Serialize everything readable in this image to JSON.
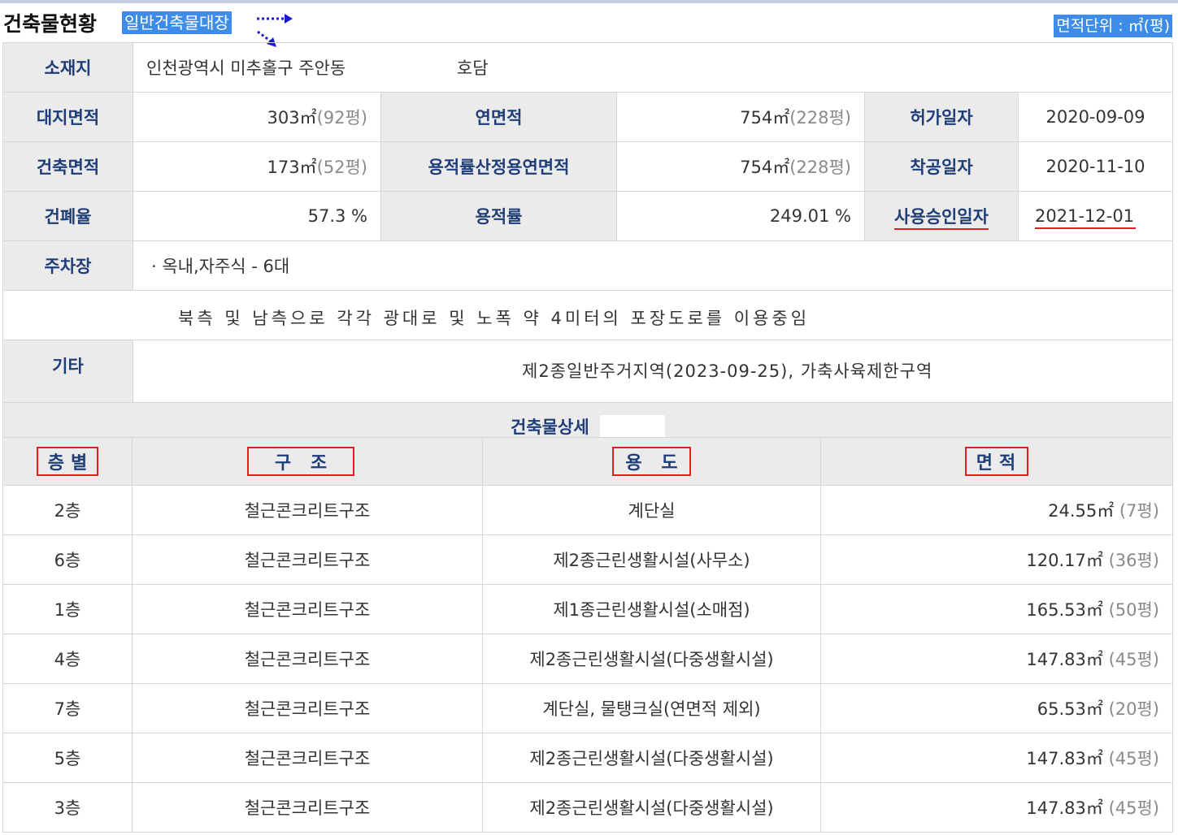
{
  "header": {
    "title": "건축물현황",
    "register_tag": "일반건축물대장",
    "area_unit": "면적단위 : ㎡(평)"
  },
  "summary": {
    "location_label": "소재지",
    "location_value": "인천광역시 미추홀구 주안동",
    "location_ho": "호담",
    "site_area_label": "대지면적",
    "site_area_m2": "303㎡",
    "site_area_py": "(92평)",
    "total_floor_area_label": "연면적",
    "total_floor_area_m2": "754㎡",
    "total_floor_area_py": "(228평)",
    "permit_date_label": "허가일자",
    "permit_date": "2020-09-09",
    "building_area_label": "건축면적",
    "building_area_m2": "173㎡",
    "building_area_py": "(52평)",
    "far_area_label": "용적률산정용연면적",
    "far_area_m2": "754㎡",
    "far_area_py": "(228평)",
    "start_date_label": "착공일자",
    "start_date": "2020-11-10",
    "coverage_label": "건폐율",
    "coverage_value": "57.3 %",
    "far_label": "용적률",
    "far_value": "249.01 %",
    "approval_date_label": "사용승인일자",
    "approval_date": "2021-12-01",
    "parking_label": "주차장",
    "parking_value": "· 옥내,자주식 - 6대",
    "road_note": "북측 및 남측으로 각각 광대로 및 노폭 약 4미터의 포장도로를 이용중임",
    "etc_label": "기타",
    "etc_value": "제2종일반주거지역(2023-09-25), 가축사육제한구역"
  },
  "detail": {
    "title": "건축물상세",
    "headers": [
      "층별",
      "구 조",
      "용 도",
      "면적"
    ],
    "rows": [
      {
        "floor": "2층",
        "structure": "철근콘크리트구조",
        "use": "계단실",
        "area_m2": "24.55㎡",
        "area_py": "(7평)"
      },
      {
        "floor": "6층",
        "structure": "철근콘크리트구조",
        "use": "제2종근린생활시설(사무소)",
        "area_m2": "120.17㎡",
        "area_py": "(36평)"
      },
      {
        "floor": "1층",
        "structure": "철근콘크리트구조",
        "use": "제1종근린생활시설(소매점)",
        "area_m2": "165.53㎡",
        "area_py": "(50평)"
      },
      {
        "floor": "4층",
        "structure": "철근콘크리트구조",
        "use": "제2종근린생활시설(다중생활시설)",
        "area_m2": "147.83㎡",
        "area_py": "(45평)"
      },
      {
        "floor": "7층",
        "structure": "철근콘크리트구조",
        "use": "계단실, 물탱크실(연면적 제외)",
        "area_m2": "65.53㎡",
        "area_py": "(20평)"
      },
      {
        "floor": "5층",
        "structure": "철근콘크리트구조",
        "use": "제2종근린생활시설(다중생활시설)",
        "area_m2": "147.83㎡",
        "area_py": "(45평)"
      },
      {
        "floor": "3층",
        "structure": "철근콘크리트구조",
        "use": "제2종근린생활시설(다중생활시설)",
        "area_m2": "147.83㎡",
        "area_py": "(45평)"
      }
    ]
  },
  "colors": {
    "header_cell_bg": "#ebebeb",
    "label_text": "#1f3e78",
    "highlight_bg": "#3d8ce8",
    "annotation_red": "#e02020",
    "annotation_arrow": "#1a1ad6"
  }
}
